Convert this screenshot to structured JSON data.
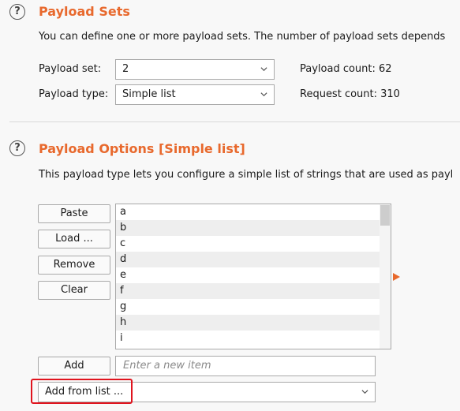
{
  "payload_sets": {
    "help_icon": "?",
    "title": "Payload Sets",
    "description": "You can define one or more payload sets. The number of payload sets depends",
    "set_label": "Payload set:",
    "set_value": "2",
    "type_label": "Payload type:",
    "type_value": "Simple list",
    "payload_count": "Payload count: 62",
    "request_count": "Request count: 310"
  },
  "payload_options": {
    "help_icon": "?",
    "title": "Payload Options [Simple list]",
    "description": "This payload type lets you configure a simple list of strings that are used as payl",
    "buttons": {
      "paste": "Paste",
      "load": "Load ...",
      "remove": "Remove",
      "clear": "Clear",
      "add": "Add"
    },
    "items": [
      "a",
      "b",
      "c",
      "d",
      "e",
      "f",
      "g",
      "h",
      "i"
    ],
    "new_item_placeholder": "Enter a new item",
    "add_from_list": "Add from list ..."
  },
  "colors": {
    "accent": "#e8692d",
    "highlight": "#e0141e"
  }
}
